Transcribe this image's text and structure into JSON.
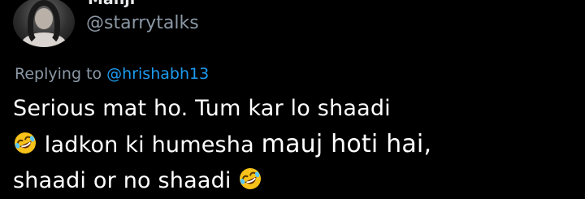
{
  "tweet": {
    "display_name": "Manjr",
    "handle": "@starrytalks",
    "replying_prefix": "Replying to",
    "replying_mention": "@hrishabh13",
    "lines": {
      "line1": "Serious mat ho. Tum kar lo shaadi",
      "line2_a": "ladkon ki humesha ",
      "line2_b": "mauj hoti hai,",
      "line3": "shaadi or no shaadi"
    },
    "emoji": "rolling-on-the-floor-laughing-emoji"
  },
  "colors": {
    "background": "#000000",
    "text": "#ffffff",
    "secondary_text": "#8b98a5",
    "mention": "#1d9bf0",
    "emoji_face": "#f7c21a"
  }
}
